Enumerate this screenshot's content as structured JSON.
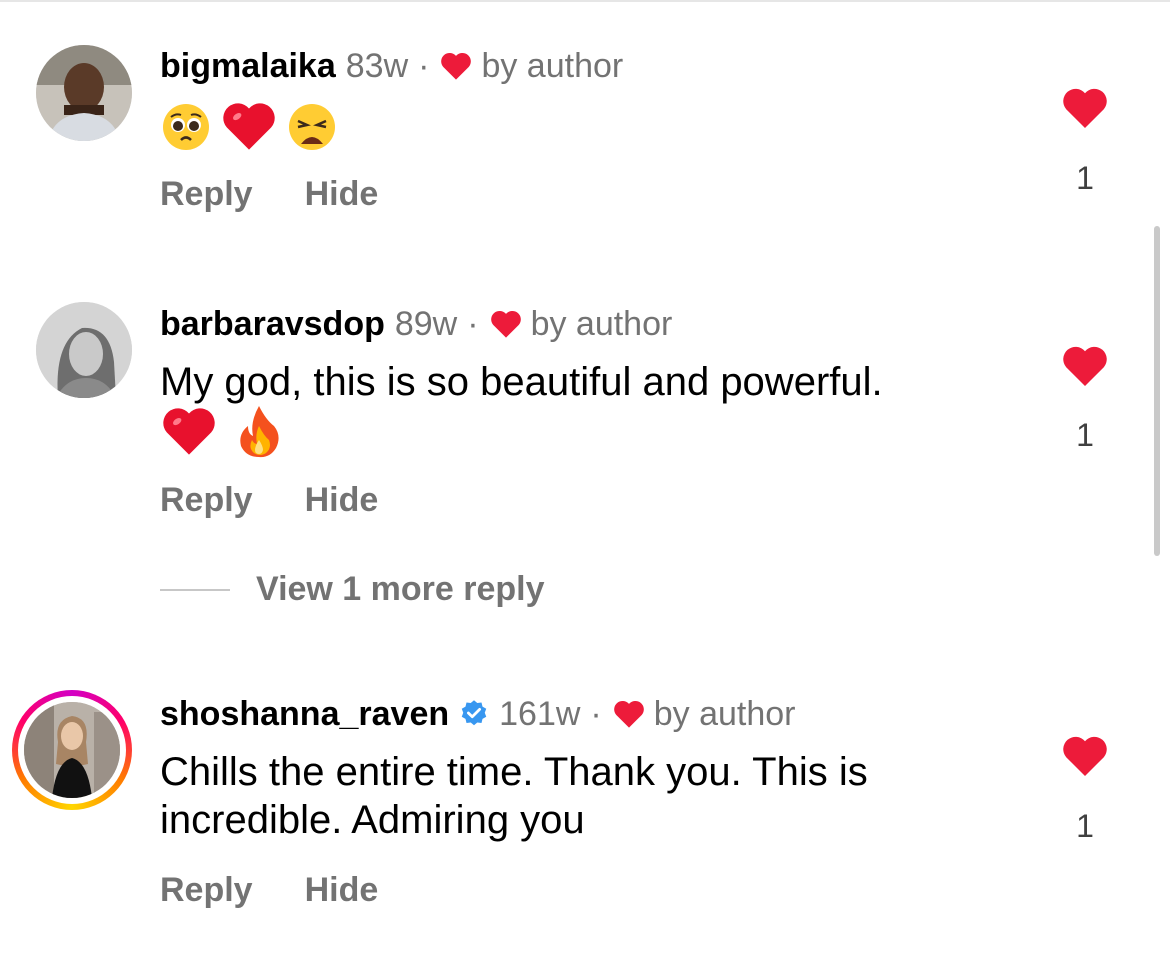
{
  "comments": [
    {
      "username": "bigmalaika",
      "time": "83w",
      "separator": "·",
      "liked_by": "by author",
      "text": "",
      "emojis": [
        "pleading-face",
        "red-heart",
        "weary-face"
      ],
      "actions": {
        "reply": "Reply",
        "hide": "Hide"
      },
      "like_count": "1"
    },
    {
      "username": "barbaravsdop",
      "time": "89w",
      "separator": "·",
      "liked_by": "by author",
      "text": "My god, this is so beautiful and powerful.",
      "emojis": [
        "red-heart",
        "fire"
      ],
      "actions": {
        "reply": "Reply",
        "hide": "Hide"
      },
      "like_count": "1",
      "view_more": "View 1 more reply"
    },
    {
      "username": "shoshanna_raven",
      "verified": true,
      "time": "161w",
      "separator": "·",
      "liked_by": "by author",
      "text": "Chills the entire time. Thank you. This is incredible. Admiring you",
      "emojis": [],
      "actions": {
        "reply": "Reply",
        "hide": "Hide"
      },
      "like_count": "1"
    }
  ],
  "colors": {
    "heart": "#ed1b3a",
    "secondary_text": "#737373",
    "verified": "#3897f0"
  },
  "icons": [
    "heart-icon",
    "verified-badge-icon"
  ]
}
